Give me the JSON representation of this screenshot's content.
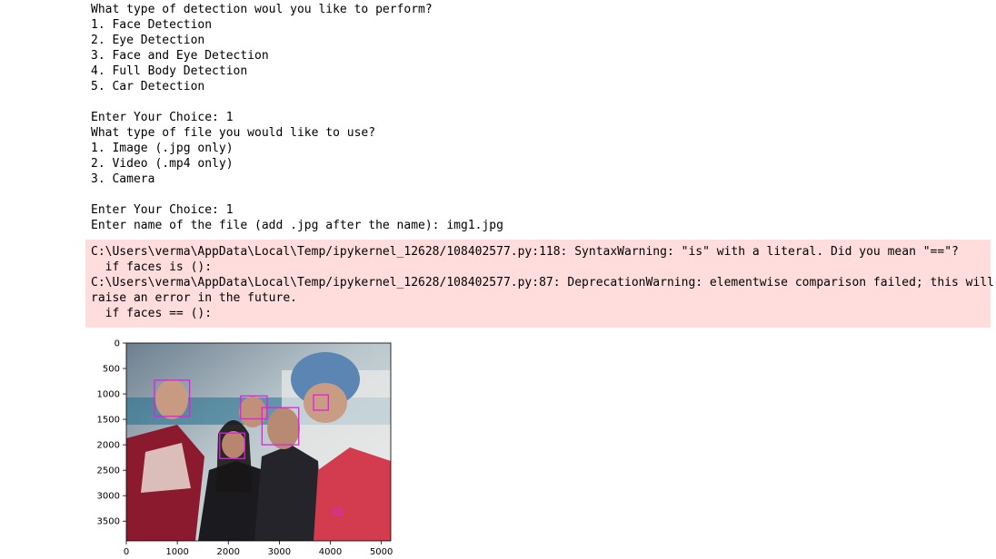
{
  "output": {
    "stdout_lines": [
      "What type of detection woul you like to perform?",
      "1. Face Detection",
      "2. Eye Detection",
      "3. Face and Eye Detection",
      "4. Full Body Detection",
      "5. Car Detection",
      "",
      "Enter Your Choice: 1",
      "What type of file you would like to use?",
      "1. Image (.jpg only)",
      "2. Video (.mp4 only)",
      "3. Camera",
      "",
      "Enter Your Choice: 1",
      "Enter name of the file (add .jpg after the name): img1.jpg"
    ],
    "stderr_lines": [
      "C:\\Users\\verma\\AppData\\Local\\Temp/ipykernel_12628/108402577.py:118: SyntaxWarning: \"is\" with a literal. Did you mean \"==\"?",
      "  if faces is ():",
      "C:\\Users\\verma\\AppData\\Local\\Temp/ipykernel_12628/108402577.py:87: DeprecationWarning: elementwise comparison failed; this will",
      "raise an error in the future.",
      "  if faces == ():"
    ]
  },
  "plot": {
    "xlim": [
      0,
      5184
    ],
    "ylim": [
      3888,
      0
    ],
    "x_ticks": [
      "0",
      "1000",
      "2000",
      "3000",
      "4000",
      "5000"
    ],
    "y_ticks": [
      "0",
      "500",
      "1000",
      "1500",
      "2000",
      "2500",
      "3000",
      "3500"
    ],
    "detection_color": "#e020e0",
    "detections": [
      {
        "x": 550,
        "y": 730,
        "w": 690,
        "h": 710
      },
      {
        "x": 2240,
        "y": 1040,
        "w": 520,
        "h": 450
      },
      {
        "x": 2660,
        "y": 1270,
        "w": 720,
        "h": 730
      },
      {
        "x": 1830,
        "y": 1770,
        "w": 490,
        "h": 500
      },
      {
        "x": 3670,
        "y": 1020,
        "w": 290,
        "h": 300
      },
      {
        "x": 4080,
        "y": 3260,
        "w": 130,
        "h": 120
      }
    ]
  }
}
